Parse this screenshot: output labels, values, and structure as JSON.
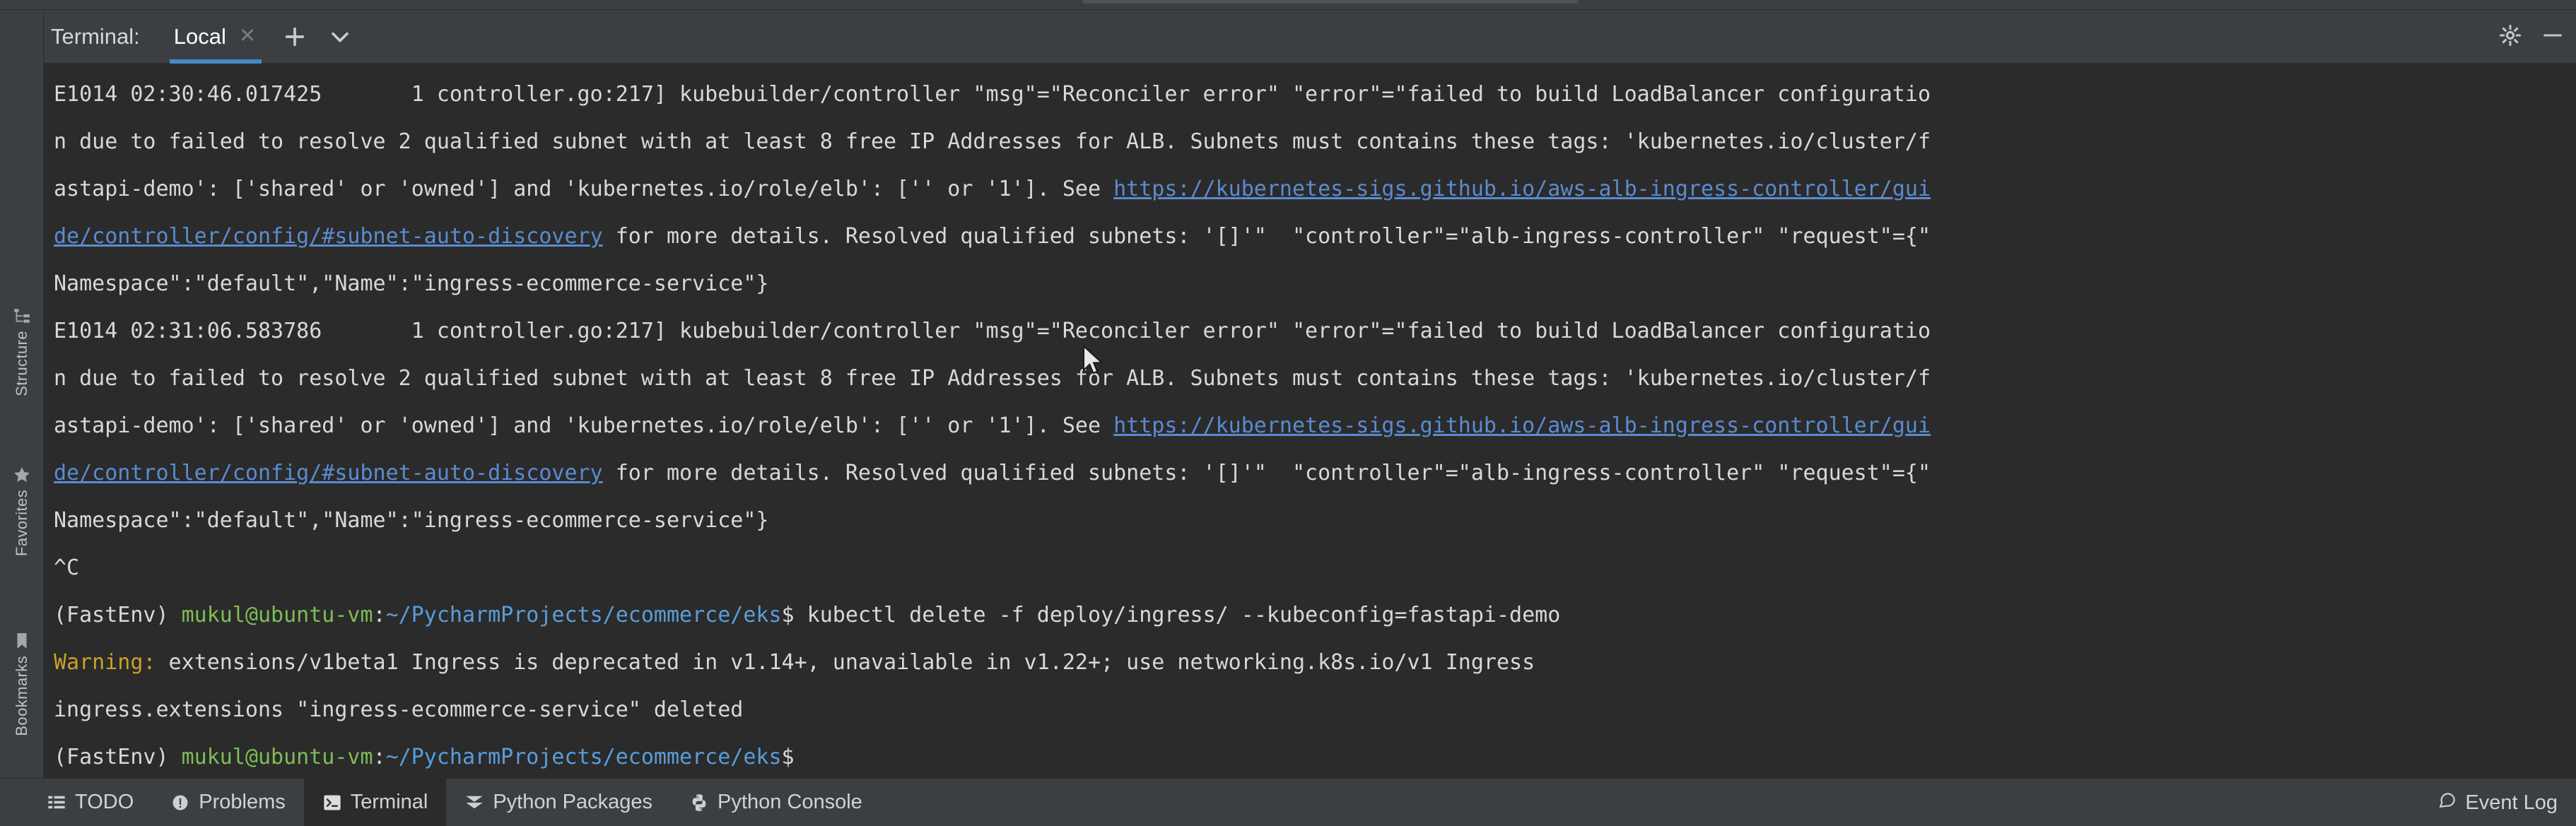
{
  "window": {
    "background": "#3c3f41",
    "terminal_background": "#2b2b2b",
    "accent": "#4a88c7",
    "link_color": "#5b8bd0",
    "prompt_user_color": "#7ebd56",
    "prompt_path_color": "#5a9ddb",
    "warning_color": "#c9a227"
  },
  "header": {
    "title": "Terminal:",
    "tabs": [
      {
        "label": "Local",
        "active": true,
        "close_icon": "close-icon"
      }
    ],
    "add_tab_icon": "plus-icon",
    "dropdown_icon": "chevron-down-icon",
    "settings_icon": "gear-icon",
    "minimize_icon": "minimize-icon"
  },
  "left_stripe": {
    "items": [
      {
        "id": "structure",
        "label": "Structure",
        "icon": "structure-icon"
      },
      {
        "id": "favorites",
        "label": "Favorites",
        "icon": "star-icon"
      },
      {
        "id": "bookmarks",
        "label": "Bookmarks",
        "icon": "bookmark-icon"
      }
    ]
  },
  "terminal": {
    "lines": [
      {
        "id": "log-1-head",
        "segments": [
          {
            "text": "E1014 02:30:46.017425       1 controller.go:217] kubebuilder/controller \"msg\"=\"Reconciler error\" \"error\"=\"failed to build LoadBalancer configuratio",
            "style": "wht"
          }
        ]
      },
      {
        "id": "log-1-cont-1",
        "segments": [
          {
            "text": "n due to failed to resolve 2 qualified subnet with at least 8 free IP Addresses for ALB. Subnets must contains these tags: 'kubernetes.io/cluster/f",
            "style": "wht"
          }
        ]
      },
      {
        "id": "log-1-cont-2",
        "segments": [
          {
            "text": "astapi-demo': ['shared' or 'owned'] and 'kubernetes.io/role/elb': ['' or '1']. See ",
            "style": "wht"
          },
          {
            "text": "https://kubernetes-sigs.github.io/aws-alb-ingress-controller/gui",
            "style": "lnk"
          }
        ]
      },
      {
        "id": "log-1-cont-3",
        "segments": [
          {
            "text": "de/controller/config/#subnet-auto-discovery",
            "style": "lnk"
          },
          {
            "text": " for more details. Resolved qualified subnets: '[]'\"  \"controller\"=\"alb-ingress-controller\" \"request\"={\"",
            "style": "wht"
          }
        ]
      },
      {
        "id": "log-1-cont-4",
        "segments": [
          {
            "text": "Namespace\":\"default\",\"Name\":\"ingress-ecommerce-service\"}",
            "style": "wht"
          }
        ]
      },
      {
        "id": "log-2-head",
        "segments": [
          {
            "text": "E1014 02:31:06.583786       1 controller.go:217] kubebuilder/controller \"msg\"=\"Reconciler error\" \"error\"=\"failed to build LoadBalancer configuratio",
            "style": "wht"
          }
        ]
      },
      {
        "id": "log-2-cont-1",
        "segments": [
          {
            "text": "n due to failed to resolve 2 qualified subnet with at least 8 free IP Addresses for ALB. Subnets must contains these tags: 'kubernetes.io/cluster/f",
            "style": "wht"
          }
        ]
      },
      {
        "id": "log-2-cont-2",
        "segments": [
          {
            "text": "astapi-demo': ['shared' or 'owned'] and 'kubernetes.io/role/elb': ['' or '1']. See ",
            "style": "wht"
          },
          {
            "text": "https://kubernetes-sigs.github.io/aws-alb-ingress-controller/gui",
            "style": "lnk"
          }
        ]
      },
      {
        "id": "log-2-cont-3",
        "segments": [
          {
            "text": "de/controller/config/#subnet-auto-discovery",
            "style": "lnk"
          },
          {
            "text": " for more details. Resolved qualified subnets: '[]'\"  \"controller\"=\"alb-ingress-controller\" \"request\"={\"",
            "style": "wht"
          }
        ]
      },
      {
        "id": "log-2-cont-4",
        "segments": [
          {
            "text": "Namespace\":\"default\",\"Name\":\"ingress-ecommerce-service\"}",
            "style": "wht"
          }
        ]
      },
      {
        "id": "interrupt",
        "segments": [
          {
            "text": "^C",
            "style": "wht"
          }
        ]
      },
      {
        "id": "prompt-1",
        "segments": [
          {
            "text": "(FastEnv) ",
            "style": "wht"
          },
          {
            "text": "mukul@ubuntu-vm",
            "style": "grn"
          },
          {
            "text": ":",
            "style": "wht"
          },
          {
            "text": "~/PycharmProjects/ecommerce/eks",
            "style": "blu"
          },
          {
            "text": "$ kubectl delete -f deploy/ingress/ --kubeconfig=fastapi-demo",
            "style": "wht"
          }
        ]
      },
      {
        "id": "warning-line",
        "segments": [
          {
            "text": "Warning:",
            "style": "ylw"
          },
          {
            "text": " extensions/v1beta1 Ingress is deprecated in v1.14+, unavailable in v1.22+; use networking.k8s.io/v1 Ingress",
            "style": "wht"
          }
        ]
      },
      {
        "id": "deleted-line",
        "segments": [
          {
            "text": "ingress.extensions \"ingress-ecommerce-service\" deleted",
            "style": "wht"
          }
        ]
      },
      {
        "id": "prompt-2",
        "segments": [
          {
            "text": "(FastEnv) ",
            "style": "wht"
          },
          {
            "text": "mukul@ubuntu-vm",
            "style": "grn"
          },
          {
            "text": ":",
            "style": "wht"
          },
          {
            "text": "~/PycharmProjects/ecommerce/eks",
            "style": "blu"
          },
          {
            "text": "$",
            "style": "wht"
          }
        ]
      }
    ]
  },
  "statusbar": {
    "items": [
      {
        "id": "todo",
        "label": "TODO",
        "icon": "list-icon",
        "active": false
      },
      {
        "id": "problems",
        "label": "Problems",
        "icon": "warning-circle-icon",
        "active": false
      },
      {
        "id": "terminal",
        "label": "Terminal",
        "icon": "terminal-icon",
        "active": true
      },
      {
        "id": "python-packages",
        "label": "Python Packages",
        "icon": "chevrons-down-icon",
        "active": false
      },
      {
        "id": "python-console",
        "label": "Python Console",
        "icon": "python-icon",
        "active": false
      }
    ],
    "event_log": {
      "label": "Event Log",
      "icon": "balloon-icon"
    }
  }
}
